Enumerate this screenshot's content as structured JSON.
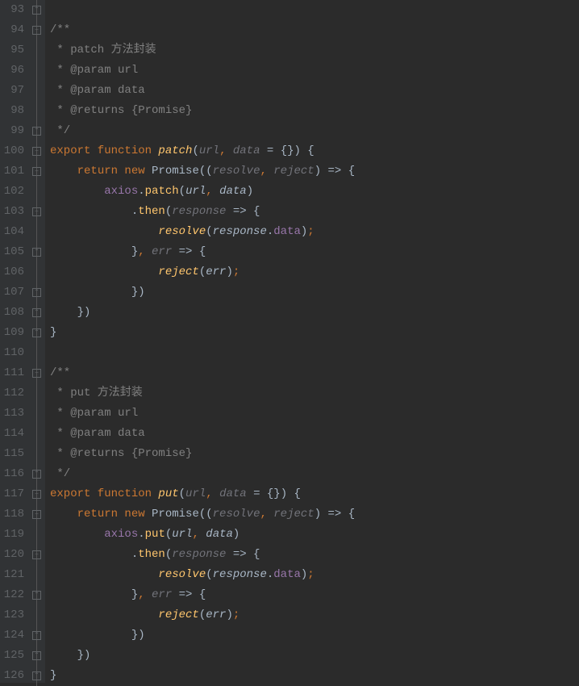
{
  "lineStart": 93,
  "lineEnd": 126,
  "lines": {
    "93": {
      "html": "",
      "fold": "end"
    },
    "94": {
      "html": "<span class='cm'>/**</span>",
      "fold": "open"
    },
    "95": {
      "html": "<span class='cm'> * patch 方法封装</span>"
    },
    "96": {
      "html": "<span class='cm'> * @param url</span>"
    },
    "97": {
      "html": "<span class='cm'> * @param data</span>"
    },
    "98": {
      "html": "<span class='cm'> * @returns {Promise}</span>"
    },
    "99": {
      "html": "<span class='cm'> */</span>",
      "fold": "end"
    },
    "100": {
      "html": "<span class='kw'>export function </span><span class='fn'>patch</span>(<span class='parit'>url</span><span class='pun'>, </span><span class='parit'>data</span> = {}) {",
      "fold": "open"
    },
    "101": {
      "html": "    <span class='kw'>return new </span>Promise((<span class='parit'>resolve</span><span class='pun'>, </span><span class='parit'>reject</span>) =&gt; {",
      "fold": "open"
    },
    "102": {
      "html": "        <span class='id'>axios</span>.<span class='call'>patch</span>(<span class='par'>url</span><span class='pun'>, </span><span class='par'>data</span>)"
    },
    "103": {
      "html": "            .<span class='call'>then</span>(<span class='parit'>response</span> =&gt; {",
      "fold": "open"
    },
    "104": {
      "html": "                <span class='fn'>resolve</span>(<span class='par'>response</span>.<span class='id'>data</span>)<span class='pun'>;</span>"
    },
    "105": {
      "html": "            }<span class='pun'>, </span><span class='parit'>err</span> =&gt; {",
      "fold": "end-open"
    },
    "106": {
      "html": "                <span class='fn'>reject</span>(<span class='par'>err</span>)<span class='pun'>;</span>"
    },
    "107": {
      "html": "            })",
      "fold": "end"
    },
    "108": {
      "html": "    })",
      "fold": "end"
    },
    "109": {
      "html": "}",
      "fold": "end"
    },
    "110": {
      "html": ""
    },
    "111": {
      "html": "<span class='cm'>/**</span>",
      "fold": "open"
    },
    "112": {
      "html": "<span class='cm'> * put 方法封装</span>"
    },
    "113": {
      "html": "<span class='cm'> * @param url</span>"
    },
    "114": {
      "html": "<span class='cm'> * @param data</span>"
    },
    "115": {
      "html": "<span class='cm'> * @returns {Promise}</span>"
    },
    "116": {
      "html": "<span class='cm'> */</span>",
      "fold": "end"
    },
    "117": {
      "html": "<span class='kw'>export function </span><span class='fn'>put</span>(<span class='parit'>url</span><span class='pun'>, </span><span class='parit'>data</span> = {}) {",
      "fold": "open"
    },
    "118": {
      "html": "    <span class='kw'>return new </span>Promise((<span class='parit'>resolve</span><span class='pun'>, </span><span class='parit'>reject</span>) =&gt; {",
      "fold": "open"
    },
    "119": {
      "html": "        <span class='id'>axios</span>.<span class='call'>put</span>(<span class='par'>url</span><span class='pun'>, </span><span class='par'>data</span>)"
    },
    "120": {
      "html": "            .<span class='call'>then</span>(<span class='parit'>response</span> =&gt; {",
      "fold": "open"
    },
    "121": {
      "html": "                <span class='fn'>resolve</span>(<span class='par'>response</span>.<span class='id'>data</span>)<span class='pun'>;</span>"
    },
    "122": {
      "html": "            }<span class='pun'>, </span><span class='parit'>err</span> =&gt; {",
      "fold": "end-open"
    },
    "123": {
      "html": "                <span class='fn'>reject</span>(<span class='par'>err</span>)<span class='pun'>;</span>"
    },
    "124": {
      "html": "            })",
      "fold": "end"
    },
    "125": {
      "html": "    })",
      "fold": "end"
    },
    "126": {
      "html": "}",
      "fold": "end"
    }
  }
}
